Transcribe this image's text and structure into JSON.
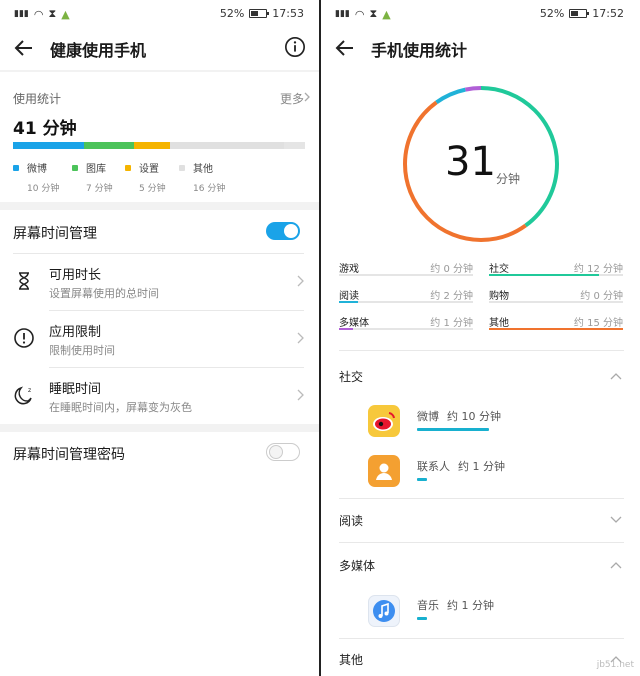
{
  "status": {
    "carrier": "4G",
    "battery": "52%",
    "time_left": "17:53",
    "time_right": "17:52"
  },
  "left": {
    "title": "健康使用手机",
    "usage": {
      "label": "使用统计",
      "more": "更多",
      "total": "41 分钟",
      "bar_total_minutes": 41,
      "segments": [
        {
          "name": "微博",
          "value": "10 分钟",
          "minutes": 10,
          "color": "#1aa3e8"
        },
        {
          "name": "图库",
          "value": "7 分钟",
          "minutes": 7,
          "color": "#4cc35a"
        },
        {
          "name": "设置",
          "value": "5 分钟",
          "minutes": 5,
          "color": "#f5b400"
        },
        {
          "name": "其他",
          "value": "16 分钟",
          "minutes": 16,
          "color": "#e0e0e0"
        }
      ]
    },
    "screen_mgmt": {
      "label": "屏幕时间管理",
      "enabled": true
    },
    "items": [
      {
        "title": "可用时长",
        "subtitle": "设置屏幕使用的总时间"
      },
      {
        "title": "应用限制",
        "subtitle": "限制使用时间"
      },
      {
        "title": "睡眠时间",
        "subtitle": "在睡眠时间内，屏幕变为灰色"
      }
    ],
    "password": {
      "label": "屏幕时间管理密码",
      "enabled": false
    }
  },
  "right": {
    "title": "手机使用统计",
    "total_number": "31",
    "total_unit": "分钟",
    "ring": [
      {
        "name": "社交",
        "minutes": 12,
        "color": "#20c99a"
      },
      {
        "name": "其他",
        "minutes": 15,
        "color": "#f0732e"
      },
      {
        "name": "阅读",
        "minutes": 2,
        "color": "#20b2d8"
      },
      {
        "name": "多媒体",
        "minutes": 1,
        "color": "#b05fd6"
      }
    ],
    "categories": [
      {
        "name": "游戏",
        "value": "约 0 分钟",
        "fraction": 0,
        "color": "#cccccc"
      },
      {
        "name": "社交",
        "value": "约 12 分钟",
        "fraction": 0.82,
        "color": "#20c99a"
      },
      {
        "name": "阅读",
        "value": "约 2 分钟",
        "fraction": 0.14,
        "color": "#20b2d8"
      },
      {
        "name": "购物",
        "value": "约 0 分钟",
        "fraction": 0,
        "color": "#cccccc"
      },
      {
        "name": "多媒体",
        "value": "约 1 分钟",
        "fraction": 0.1,
        "color": "#b05fd6"
      },
      {
        "name": "其他",
        "value": "约 15 分钟",
        "fraction": 1.0,
        "color": "#f0732e"
      }
    ],
    "sections": {
      "social": "社交",
      "reading": "阅读",
      "media": "多媒体",
      "other": "其他"
    },
    "apps": {
      "weibo": {
        "name": "微博",
        "value": "约 10 分钟",
        "fraction": 1.0
      },
      "contacts": {
        "name": "联系人",
        "value": "约 1 分钟",
        "fraction": 0.14
      },
      "music": {
        "name": "音乐",
        "value": "约 1 分钟",
        "fraction": 0.14
      }
    },
    "watermark": "jb51.net"
  }
}
